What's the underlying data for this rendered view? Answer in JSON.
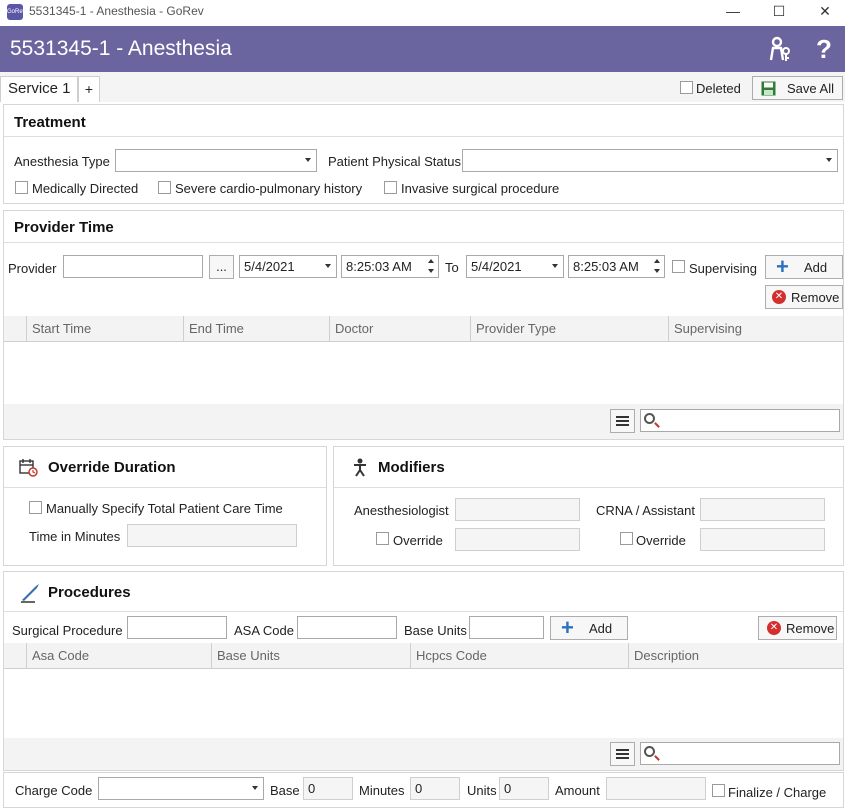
{
  "window": {
    "title": "5531345-1 - Anesthesia - GoRev",
    "app_icon": "GoRev",
    "minimize": "—",
    "maximize": "☐",
    "close": "✕"
  },
  "header": {
    "title": "5531345-1 - Anesthesia",
    "color": "#6b659f",
    "icons": [
      "users-key-icon",
      "help-icon"
    ],
    "help_glyph": "?"
  },
  "tabs": [
    {
      "label": "Service 1",
      "active": true
    },
    {
      "label": "+"
    }
  ],
  "toolbar": {
    "deleted_label": "Deleted",
    "save_all_label": "Save All"
  },
  "treatment": {
    "title": "Treatment",
    "anesthesia_type_label": "Anesthesia Type",
    "anesthesia_type_value": "",
    "patient_status_label": "Patient Physical Status",
    "patient_status_value": "",
    "checkboxes": [
      "Medically Directed",
      "Severe cardio-pulmonary history",
      "Invasive surgical procedure"
    ]
  },
  "provider_time": {
    "title": "Provider Time",
    "provider_label": "Provider",
    "provider_value": "",
    "browse_label": "...",
    "start_date": "5/4/2021",
    "start_time": "8:25:03 AM",
    "to_label": "To",
    "end_date": "5/4/2021",
    "end_time": "8:25:03 AM",
    "supervising_label": "Supervising",
    "add_label": "Add",
    "remove_label": "Remove",
    "columns": [
      "Start Time",
      "End Time",
      "Doctor",
      "Provider Type",
      "Supervising"
    ],
    "search_value": ""
  },
  "override_duration": {
    "title": "Override Duration",
    "manual_label": "Manually Specify Total Patient Care Time",
    "minutes_label": "Time in Minutes",
    "minutes_value": ""
  },
  "modifiers": {
    "title": "Modifiers",
    "anesthesiologist_label": "Anesthesiologist",
    "anesthesiologist_value": "",
    "crna_label": "CRNA / Assistant",
    "crna_value": "",
    "override_label": "Override",
    "override_value_1": "",
    "override_value_2": ""
  },
  "procedures": {
    "title": "Procedures",
    "surgical_label": "Surgical Procedure",
    "surgical_value": "",
    "asa_label": "ASA Code",
    "asa_value": "",
    "base_units_label": "Base Units",
    "base_units_value": "",
    "add_label": "Add",
    "remove_label": "Remove",
    "columns": [
      "Asa Code",
      "Base Units",
      "Hcpcs Code",
      "Description"
    ],
    "search_value": ""
  },
  "charge": {
    "charge_code_label": "Charge Code",
    "charge_code_value": "",
    "base_label": "Base",
    "base_value": "0",
    "minutes_label": "Minutes",
    "minutes_value": "0",
    "units_label": "Units",
    "units_value": "0",
    "amount_label": "Amount",
    "amount_value": "",
    "finalize_label": "Finalize / Charge"
  }
}
